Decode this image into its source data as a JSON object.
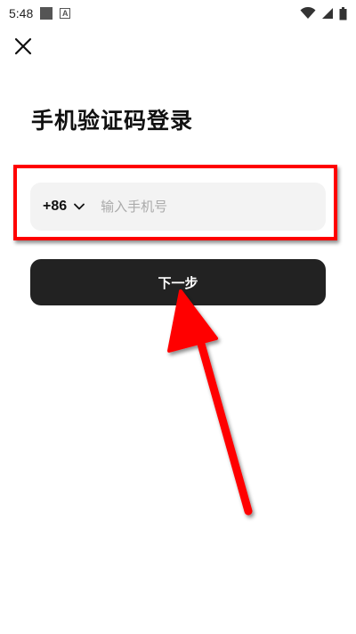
{
  "status_bar": {
    "time": "5:48",
    "notification_letter": "A",
    "icons": [
      "square-notification-icon",
      "a-notification-icon",
      "wifi-icon",
      "signal-icon",
      "battery-icon"
    ]
  },
  "header": {
    "close_icon": "close-icon"
  },
  "main": {
    "title": "手机验证码登录",
    "country_code": "+86",
    "country_dropdown_icon": "chevron-down-icon",
    "phone_placeholder": "输入手机号",
    "phone_value": "",
    "next_label": "下一步"
  },
  "annotations": {
    "highlight_color": "#ff0000",
    "arrow_color": "#ff0000"
  },
  "colors": {
    "button_bg": "#222222",
    "input_bg": "#f3f3f3"
  }
}
